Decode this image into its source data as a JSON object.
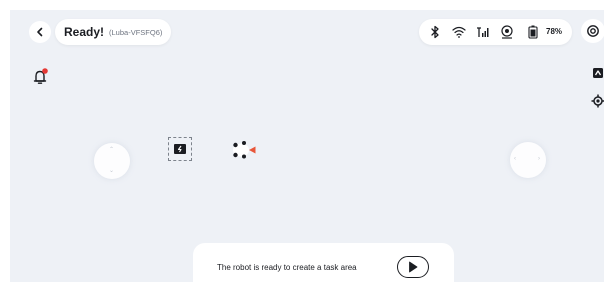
{
  "header": {
    "title": "Ready!",
    "device_name": "(Luba-VFSFQ6)",
    "battery_percent": "78%",
    "status_icons": [
      "bluetooth-icon",
      "wifi-icon",
      "cellular-signal-icon",
      "gps-icon",
      "battery-icon"
    ],
    "settings_icon": "settings-icon"
  },
  "left_controls": {
    "notification_icon": "bell-icon",
    "has_unread": true
  },
  "right_controls": {
    "items": [
      "map-view-icon",
      "locate-icon"
    ]
  },
  "map": {
    "charging_station_icon": "charging-station-icon",
    "robot_icon": "mower-robot-icon",
    "left_joystick": "left-joystick",
    "right_joystick": "right-joystick"
  },
  "bottom_panel": {
    "message": "The robot is ready to create a task area",
    "action_icon": "play-icon"
  },
  "colors": {
    "background": "#eef1f6",
    "surface": "#ffffff",
    "text": "#1b1d22",
    "alert_red": "#e53935",
    "accent_red": "#e8563a"
  }
}
